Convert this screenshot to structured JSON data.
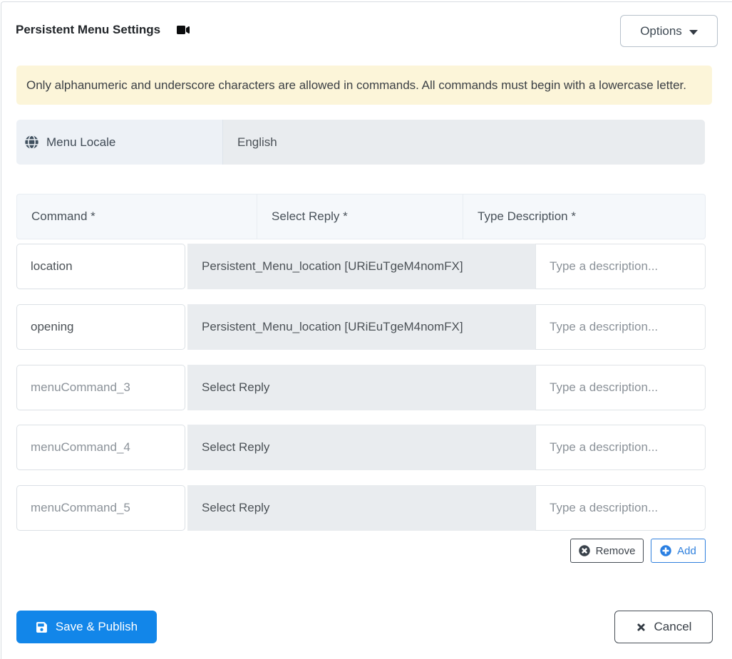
{
  "header": {
    "title": "Persistent Menu Settings",
    "options_label": "Options"
  },
  "alert": {
    "text": "Only alphanumeric and underscore characters are allowed in commands. All commands must begin with a lowercase letter."
  },
  "locale": {
    "label": "Menu Locale",
    "value": "English"
  },
  "table": {
    "headers": {
      "command": "Command *",
      "reply": "Select Reply *",
      "description": "Type Description *"
    },
    "description_placeholder": "Type a description...",
    "rows": [
      {
        "command": "location",
        "command_is_placeholder": false,
        "reply": "Persistent_Menu_location [URiEuTgeM4nomFX]"
      },
      {
        "command": "opening",
        "command_is_placeholder": false,
        "reply": "Persistent_Menu_location [URiEuTgeM4nomFX]"
      },
      {
        "command": "menuCommand_3",
        "command_is_placeholder": true,
        "reply": "Select Reply"
      },
      {
        "command": "menuCommand_4",
        "command_is_placeholder": true,
        "reply": "Select Reply"
      },
      {
        "command": "menuCommand_5",
        "command_is_placeholder": true,
        "reply": "Select Reply"
      }
    ],
    "remove_label": "Remove",
    "add_label": "Add"
  },
  "footer": {
    "save_label": "Save & Publish",
    "cancel_label": "Cancel"
  },
  "colors": {
    "primary_blue": "#1286e9",
    "add_blue": "#2f80dd",
    "alert_bg": "#fcf5d9",
    "select_bg": "#e9ecef"
  }
}
